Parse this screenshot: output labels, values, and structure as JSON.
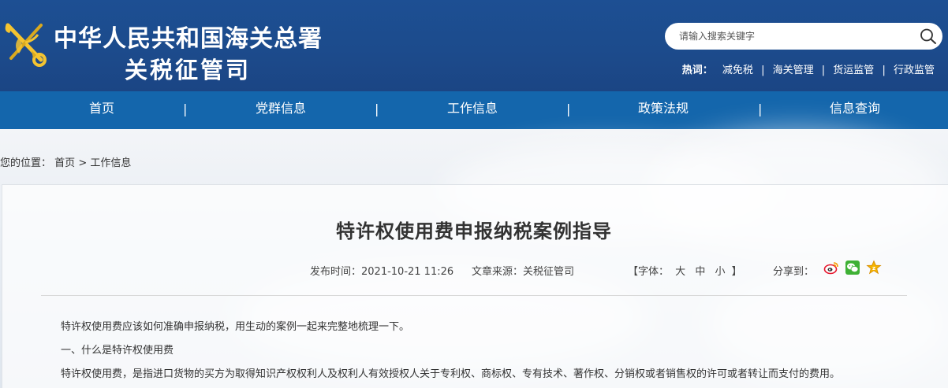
{
  "header": {
    "title_line1": "中华人民共和国海关总署",
    "title_line2": "关税征管司",
    "search_placeholder": "请输入搜索关键字",
    "hot_label": "热词：",
    "hot_words": [
      "减免税",
      "海关管理",
      "货运监管",
      "行政监管"
    ],
    "hot_separator": "|"
  },
  "nav": {
    "items": [
      "首页",
      "党群信息",
      "工作信息",
      "政策法规",
      "信息查询"
    ],
    "separator": "|"
  },
  "breadcrumb": {
    "prefix": "您的位置：",
    "home": "首页",
    "arrow": ">",
    "current": "工作信息"
  },
  "article": {
    "title": "特许权使用费申报纳税案例指导",
    "publish_time": "发布时间：2021-10-21 11:26",
    "source": "文章来源：关税征管司",
    "font_open": "【字体：",
    "font_large": "大",
    "font_medium": "中",
    "font_small": "小",
    "font_close": "】",
    "share_label": "分享到：",
    "share_targets": [
      "weibo-icon",
      "wechat-icon",
      "favorite-icon"
    ],
    "paragraphs": [
      "特许权使用费应该如何准确申报纳税，用生动的案例一起来完整地梳理一下。",
      "一、什么是特许权使用费",
      "特许权使用费，是指进口货物的买方为取得知识产权权利人及权利人有效授权人关于专利权、商标权、专有技术、著作权、分销权或者销售权的许可或者转让而支付的费用。"
    ]
  },
  "colors": {
    "header_bg": "#1c4b8c",
    "nav_bg": "#1466ac",
    "text": "#333333"
  }
}
